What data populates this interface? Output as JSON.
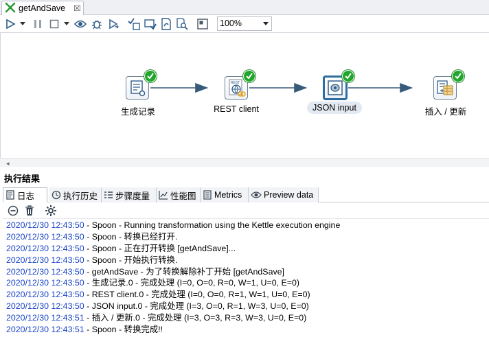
{
  "editor_tab": {
    "title": "getAndSave",
    "close_glyph": "☒"
  },
  "toolbar": {
    "zoom_value": "100%",
    "icons": [
      "run-icon",
      "run-dropdown-icon",
      "pause-icon",
      "stop-icon",
      "stop-dropdown-icon",
      "preview-icon",
      "debug-icon",
      "replay-icon",
      "verify-icon",
      "impact-icon",
      "sql-icon",
      "explore-db-icon",
      "show-results-icon"
    ]
  },
  "canvas": {
    "steps": [
      {
        "id": "generate",
        "label": "生成记录",
        "icon": "generate-rows-icon",
        "status": "success"
      },
      {
        "id": "rest",
        "label": "REST client",
        "icon": "rest-client-icon",
        "status": "success"
      },
      {
        "id": "json",
        "label": "JSON input",
        "icon": "json-input-icon",
        "status": "success",
        "selected": true
      },
      {
        "id": "insert",
        "label": "插入 / 更新",
        "icon": "insert-update-icon",
        "status": "success"
      }
    ],
    "hop_color": "#385b7a"
  },
  "results": {
    "title": "执行结果",
    "tabs": [
      {
        "label": "日志",
        "icon": "log-icon",
        "active": true
      },
      {
        "label": "执行历史",
        "icon": "history-icon"
      },
      {
        "label": "步骤度量",
        "icon": "step-metrics-icon"
      },
      {
        "label": "性能图",
        "icon": "performance-icon"
      },
      {
        "label": "Metrics",
        "icon": "metrics-icon"
      },
      {
        "label": "Preview data",
        "icon": "preview-data-icon"
      }
    ],
    "log_toolbar": [
      "clear-log-icon",
      "delete-icon",
      "settings-icon"
    ],
    "log": [
      {
        "ts": "2020/12/30 12:43:50",
        "msg": " - Spoon - Running transformation using the Kettle execution engine"
      },
      {
        "ts": "2020/12/30 12:43:50",
        "msg": " - Spoon - 转换已经打开."
      },
      {
        "ts": "2020/12/30 12:43:50",
        "msg": " - Spoon - 正在打开转换 [getAndSave]..."
      },
      {
        "ts": "2020/12/30 12:43:50",
        "msg": " - Spoon - 开始执行转换."
      },
      {
        "ts": "2020/12/30 12:43:50",
        "msg": " - getAndSave - 为了转换解除补丁开始  [getAndSave]"
      },
      {
        "ts": "2020/12/30 12:43:50",
        "msg": " - 生成记录.0 - 完成处理 (I=0, O=0, R=0, W=1, U=0, E=0)"
      },
      {
        "ts": "2020/12/30 12:43:50",
        "msg": " - REST client.0 - 完成处理 (I=0, O=0, R=1, W=1, U=0, E=0)"
      },
      {
        "ts": "2020/12/30 12:43:50",
        "msg": " - JSON input.0 - 完成处理 (I=3, O=0, R=1, W=3, U=0, E=0)"
      },
      {
        "ts": "2020/12/30 12:43:51",
        "msg": " - 插入 / 更新.0 - 完成处理 (I=3, O=3, R=3, W=3, U=0, E=0)"
      },
      {
        "ts": "2020/12/30 12:43:51",
        "msg": " - Spoon - 转换完成!!"
      }
    ]
  }
}
